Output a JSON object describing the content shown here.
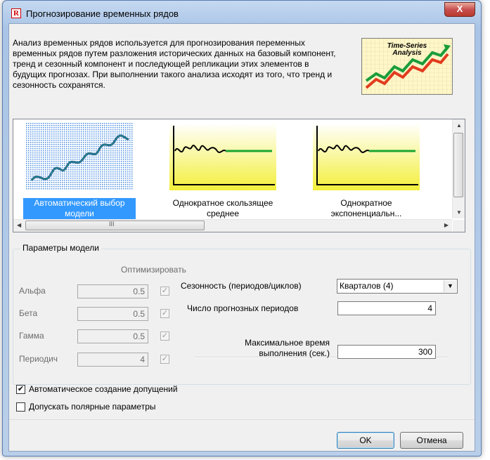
{
  "window": {
    "title": "Прогнозирование временных рядов",
    "app_icon_letter": "R",
    "close_label": "X"
  },
  "intro": {
    "text": "Анализ временных рядов используется для прогнозирования переменных временных рядов путем разложения исторических данных на базовый компонент, тренд и сезонный компонент и последующей репликации этих элементов в будущих прогнозах. При выполнении такого анализа исходят из того, что тренд и сезонность сохранятся.",
    "logo_text_line1": "Time-Series",
    "logo_text_line2": "Analysis"
  },
  "models": [
    {
      "label": "Автоматический выбор модели",
      "selected": true
    },
    {
      "label": "Однократное скользящее среднее",
      "selected": false
    },
    {
      "label": "Однократное экспоненциальн...",
      "selected": false
    }
  ],
  "scrollbar": {
    "h_thumb_grip": "III"
  },
  "params": {
    "title": "Параметры модели",
    "optimize_header": "Оптимизировать",
    "rows": [
      {
        "label": "Альфа",
        "value": "0.5",
        "optimize": true
      },
      {
        "label": "Бета",
        "value": "0.5",
        "optimize": true
      },
      {
        "label": "Гамма",
        "value": "0.5",
        "optimize": true
      },
      {
        "label": "Периодич",
        "value": "4",
        "optimize": true
      }
    ],
    "seasonality_label": "Сезонность (периодов/циклов)",
    "seasonality_value": "Кварталов (4)",
    "forecast_periods_label": "Число прогнозных периодов",
    "forecast_periods_value": "4",
    "max_time_label_line1": "Максимальное время",
    "max_time_label_line2": "выполнения (сек.)",
    "max_time_value": "300"
  },
  "options": {
    "auto_assumptions_label": "Автоматическое создание допущений",
    "auto_assumptions_checked": true,
    "polar_params_label": "Допускать полярные параметры",
    "polar_params_checked": false
  },
  "buttons": {
    "ok": "OK",
    "cancel": "Отмена"
  },
  "colors": {
    "selection": "#3399ff",
    "chart_line_green": "#1aa533",
    "chart_bg_yellow": "#f6f25a"
  }
}
